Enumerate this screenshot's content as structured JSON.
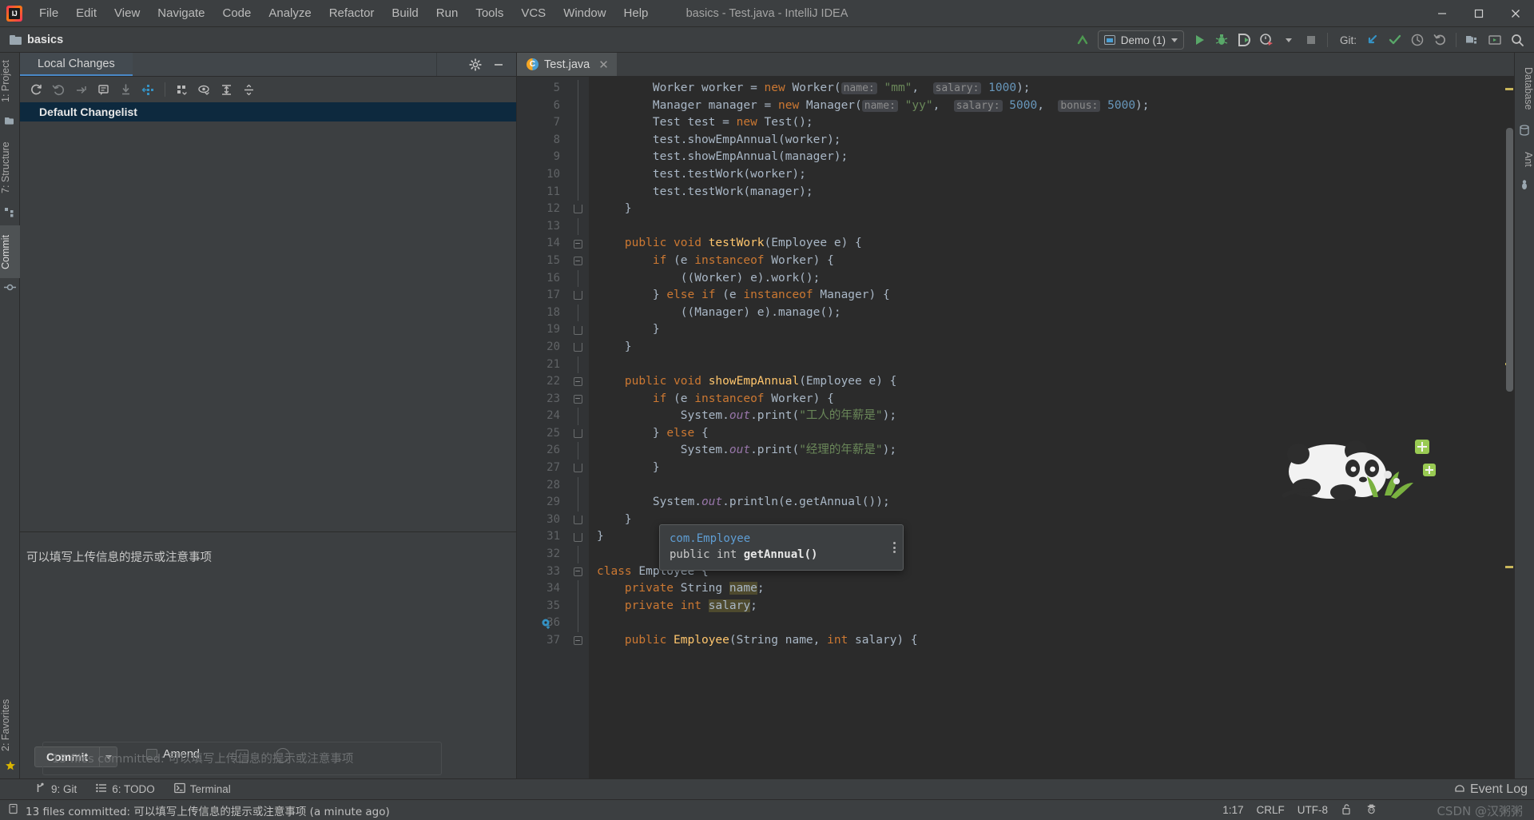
{
  "window": {
    "title": "basics - Test.java - IntelliJ IDEA",
    "app_icon": "intellij-logo-icon",
    "controls": {
      "minimize": "─",
      "maximize": "❐",
      "close": "✕"
    }
  },
  "menubar": {
    "items": [
      "File",
      "Edit",
      "View",
      "Navigate",
      "Code",
      "Analyze",
      "Refactor",
      "Build",
      "Run",
      "Tools",
      "VCS",
      "Window",
      "Help"
    ]
  },
  "navbar": {
    "project": "basics",
    "run_config": "Demo (1)",
    "git_label": "Git:",
    "icons": {
      "back_arrow": "green-arrow-up-icon",
      "run": "run-icon",
      "debug": "debug-icon",
      "run_coverage": "run-with-coverage-icon",
      "profiler": "profiler-icon",
      "stop": "stop-icon",
      "update": "git-update-icon",
      "commit": "git-commit-icon",
      "history": "git-history-icon",
      "rollback": "git-rollback-icon",
      "project_structure": "project-structure-icon",
      "run_anything": "run-anything-icon",
      "search": "search-everywhere-icon"
    }
  },
  "left_strip": {
    "items": [
      {
        "label": "1: Project",
        "icon": "project-folder-icon",
        "active": false
      },
      {
        "label": "7: Structure",
        "icon": "structure-icon",
        "active": false
      },
      {
        "label": "Commit",
        "icon": "commit-icon",
        "active": true
      }
    ],
    "bottom": {
      "label": "2: Favorites",
      "icon": "favorites-star-icon"
    }
  },
  "right_strip": {
    "items": [
      {
        "label": "Database",
        "icon": "database-icon"
      },
      {
        "label": "Ant",
        "icon": "ant-icon"
      }
    ]
  },
  "commit_panel": {
    "tab": "Local Changes",
    "tab_buttons": {
      "settings": "gear-icon",
      "hide": "hide-icon"
    },
    "toolbar_icons": [
      "refresh-icon",
      "rollback-icon",
      "shelve-icon",
      "show-diff-icon",
      "unshelve-icon",
      "move-to-changelist-icon",
      "group-by-icon",
      "preview-icon",
      "expand-all-icon",
      "collapse-all-icon"
    ],
    "changelist": "Default Changelist",
    "commit_message": "可以填写上传信息的提示或注意事项",
    "commit_button": "Commit",
    "amend_label": "Amend",
    "ghost_notification": "13 files committed: 可以填写上传信息的提示或注意事项"
  },
  "editor": {
    "tab": {
      "filename": "Test.java",
      "icon": "java-class-icon",
      "close": "✕"
    },
    "first_line": 5,
    "lines": [
      {
        "n": 5,
        "fold": "",
        "html": "        <span class=\"typ\">Worker</span> worker = <span class=\"kw\">new</span> <span class=\"typ\">Worker</span>(<span class=\"hint\">name:</span> <span class=\"str\">\"mm\"</span>,  <span class=\"hint\">salary:</span> <span class=\"num\">1000</span>);"
      },
      {
        "n": 6,
        "fold": "",
        "html": "        <span class=\"typ\">Manager</span> manager = <span class=\"kw\">new</span> <span class=\"typ\">Manager</span>(<span class=\"hint\">name:</span> <span class=\"str\">\"yy\"</span>,  <span class=\"hint\">salary:</span> <span class=\"num\">5000</span>,  <span class=\"hint\">bonus:</span> <span class=\"num\">5000</span>);"
      },
      {
        "n": 7,
        "fold": "",
        "html": "        <span class=\"typ\">Test</span> test = <span class=\"kw\">new</span> <span class=\"typ\">Test</span>();"
      },
      {
        "n": 8,
        "fold": "",
        "html": "        test.showEmpAnnual(worker);"
      },
      {
        "n": 9,
        "fold": "",
        "html": "        test.showEmpAnnual(manager);"
      },
      {
        "n": 10,
        "fold": "",
        "html": "        test.testWork(worker);"
      },
      {
        "n": 11,
        "fold": "",
        "html": "        test.testWork(manager);"
      },
      {
        "n": 12,
        "fold": "end",
        "html": "    }"
      },
      {
        "n": 13,
        "fold": "",
        "html": ""
      },
      {
        "n": 14,
        "fold": "start",
        "html": "    <span class=\"kw\">public void</span> <span class=\"fn\">testWork</span>(<span class=\"typ\">Employee</span> e) {"
      },
      {
        "n": 15,
        "fold": "start",
        "html": "        <span class=\"kw\">if</span> (e <span class=\"kw\">instanceof</span> <span class=\"typ\">Worker</span>) {"
      },
      {
        "n": 16,
        "fold": "",
        "html": "            ((<span class=\"typ\">Worker</span>) e).work();"
      },
      {
        "n": 17,
        "fold": "end",
        "html": "        } <span class=\"kw\">else if</span> (e <span class=\"kw\">instanceof</span> <span class=\"typ\">Manager</span>) {"
      },
      {
        "n": 18,
        "fold": "",
        "html": "            ((<span class=\"typ\">Manager</span>) e).manage();"
      },
      {
        "n": 19,
        "fold": "end",
        "html": "        }"
      },
      {
        "n": 20,
        "fold": "end",
        "html": "    }"
      },
      {
        "n": 21,
        "fold": "",
        "html": ""
      },
      {
        "n": 22,
        "fold": "start",
        "html": "    <span class=\"kw\">public void</span> <span class=\"fn\">showEmpAnnual</span>(<span class=\"typ\">Employee</span> e) {"
      },
      {
        "n": 23,
        "fold": "start",
        "html": "        <span class=\"kw\">if</span> (e <span class=\"kw\">instanceof</span> <span class=\"typ\">Worker</span>) {"
      },
      {
        "n": 24,
        "fold": "",
        "html": "            System.<span class=\"stat\">out</span>.print(<span class=\"str\">\"工人的年薪是\"</span>);"
      },
      {
        "n": 25,
        "fold": "end",
        "html": "        } <span class=\"kw\">else</span> {"
      },
      {
        "n": 26,
        "fold": "",
        "html": "            System.<span class=\"stat\">out</span>.print(<span class=\"str\">\"经理的年薪是\"</span>);"
      },
      {
        "n": 27,
        "fold": "end",
        "html": "        }"
      },
      {
        "n": 28,
        "fold": "",
        "html": ""
      },
      {
        "n": 29,
        "fold": "",
        "html": "        System.<span class=\"stat\">out</span>.println(e.getAnnual());"
      },
      {
        "n": 30,
        "fold": "end",
        "html": "    }"
      },
      {
        "n": 31,
        "fold": "end",
        "html": "}"
      },
      {
        "n": 32,
        "fold": "",
        "html": ""
      },
      {
        "n": 33,
        "fold": "start",
        "html": "<span class=\"kw\">class</span> <span class=\"typ\">Employee</span> {"
      },
      {
        "n": 34,
        "fold": "",
        "html": "    <span class=\"kw\">private</span> <span class=\"typ\">String</span> <span class=\"hl-ident\">name</span>;"
      },
      {
        "n": 35,
        "fold": "",
        "html": "    <span class=\"kw\">private int</span> <span class=\"hl-ident\">salary</span>;"
      },
      {
        "n": 36,
        "fold": "",
        "html": ""
      },
      {
        "n": 37,
        "fold": "start",
        "html": "    <span class=\"kw\">public</span> <span class=\"fn\">Employee</span>(<span class=\"typ\">String</span> name, <span class=\"kw\">int</span> salary) {"
      }
    ],
    "doc_popup": {
      "qualified_name": "com.Employee",
      "signature_prefix": "public int ",
      "signature_name": "getAnnual()",
      "menu_icon": "more-options-icon"
    }
  },
  "bottom_strip": {
    "items": [
      {
        "label": "9: Git",
        "icon": "git-branch-icon"
      },
      {
        "label": "6: TODO",
        "icon": "todo-list-icon"
      },
      {
        "label": "Terminal",
        "icon": "terminal-icon"
      }
    ],
    "event_log": {
      "label": "Event Log",
      "icon": "event-log-icon"
    }
  },
  "statusbar": {
    "message": "13 files committed: 可以填写上传信息的提示或注意事项 (a minute ago)",
    "message_icon": "copy-icon",
    "caret": "1:17",
    "line_separator": "CRLF",
    "encoding": "UTF-8",
    "lock_icon": "unlocked-icon",
    "inspection_icon": "hector-icon",
    "watermark": "CSDN @汉粥粥"
  },
  "colors": {
    "bg_chrome": "#3c3f41",
    "bg_editor": "#2b2b2b",
    "bg_gutter": "#313335",
    "accent_blue": "#4a88c7",
    "selection_blue": "#0d293e",
    "keyword_orange": "#cc7832",
    "string_green": "#6a8759",
    "number_blue": "#6897bb",
    "method_yellow": "#ffc66d",
    "field_purple": "#9876aa",
    "text_default": "#a9b7c6"
  }
}
